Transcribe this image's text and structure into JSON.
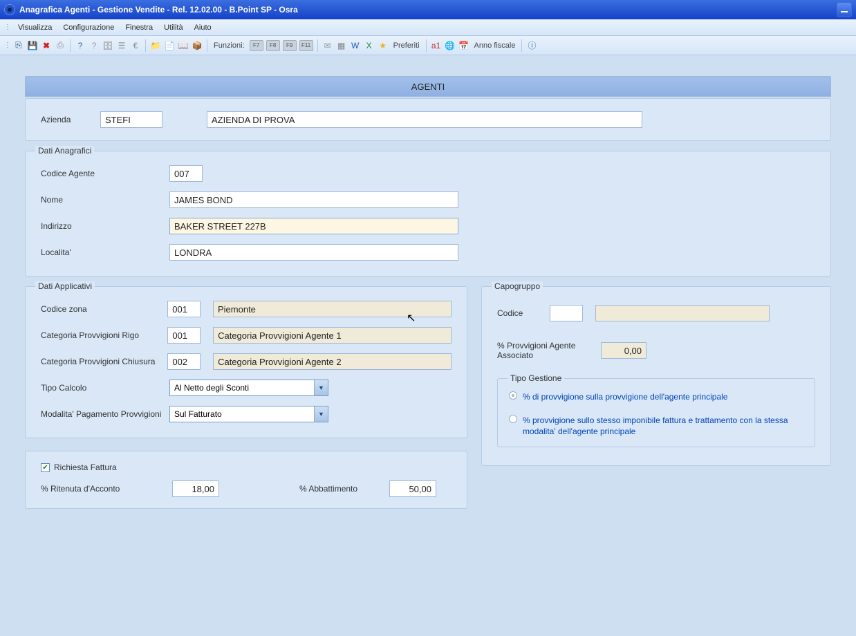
{
  "window": {
    "title": "Anagrafica Agenti - Gestione Vendite - Rel. 12.02.00 - B.Point SP - Osra"
  },
  "menu": {
    "items": [
      "Visualizza",
      "Configurazione",
      "Finestra",
      "Utilità",
      "Aiuto"
    ]
  },
  "toolbar": {
    "funzioni": "Funzioni:",
    "fkeys": [
      "F7",
      "F8",
      "F9",
      "F11"
    ],
    "preferiti": "Preferiti",
    "anno_fiscale": "Anno fiscale"
  },
  "header": {
    "title": "AGENTI"
  },
  "azienda": {
    "label": "Azienda",
    "code": "STEFI",
    "name": "AZIENDA DI PROVA"
  },
  "anagrafici": {
    "legend": "Dati Anagrafici",
    "codice_label": "Codice Agente",
    "codice": "007",
    "nome_label": "Nome",
    "nome": "JAMES BOND",
    "indirizzo_label": "Indirizzo",
    "indirizzo": "BAKER STREET 227B",
    "localita_label": "Localita'",
    "localita": "LONDRA"
  },
  "applicativi": {
    "legend": "Dati Applicativi",
    "zona_label": "Codice zona",
    "zona_code": "001",
    "zona_desc": "Piemonte",
    "cat_rigo_label": "Categoria Provvigioni Rigo",
    "cat_rigo_code": "001",
    "cat_rigo_desc": "Categoria Provvigioni Agente 1",
    "cat_chiusura_label": "Categoria  Provvigioni Chiusura",
    "cat_chiusura_code": "002",
    "cat_chiusura_desc": "Categoria Provvigioni Agente 2",
    "tipo_calcolo_label": "Tipo Calcolo",
    "tipo_calcolo": "Al Netto degli Sconti",
    "modalita_label": "Modalita' Pagamento Provvigioni",
    "modalita": "Sul Fatturato"
  },
  "fattura": {
    "richiesta_label": "Richiesta Fattura",
    "ritenuta_label": "% Ritenuta d'Acconto",
    "ritenuta": "18,00",
    "abbattimento_label": "% Abbattimento",
    "abbattimento": "50,00"
  },
  "capogruppo": {
    "legend": "Capogruppo",
    "codice_label": "Codice",
    "codice": "",
    "desc": "",
    "perc_label": "% Provvigioni Agente  Associato",
    "perc": "0,00",
    "tipo_gestione_legend": "Tipo Gestione",
    "opt1": "% di provvigione sulla provvigione dell'agente principale",
    "opt2": "% provvigione sullo stesso imponibile fattura e trattamento con la stessa modalita' dell'agente principale"
  }
}
